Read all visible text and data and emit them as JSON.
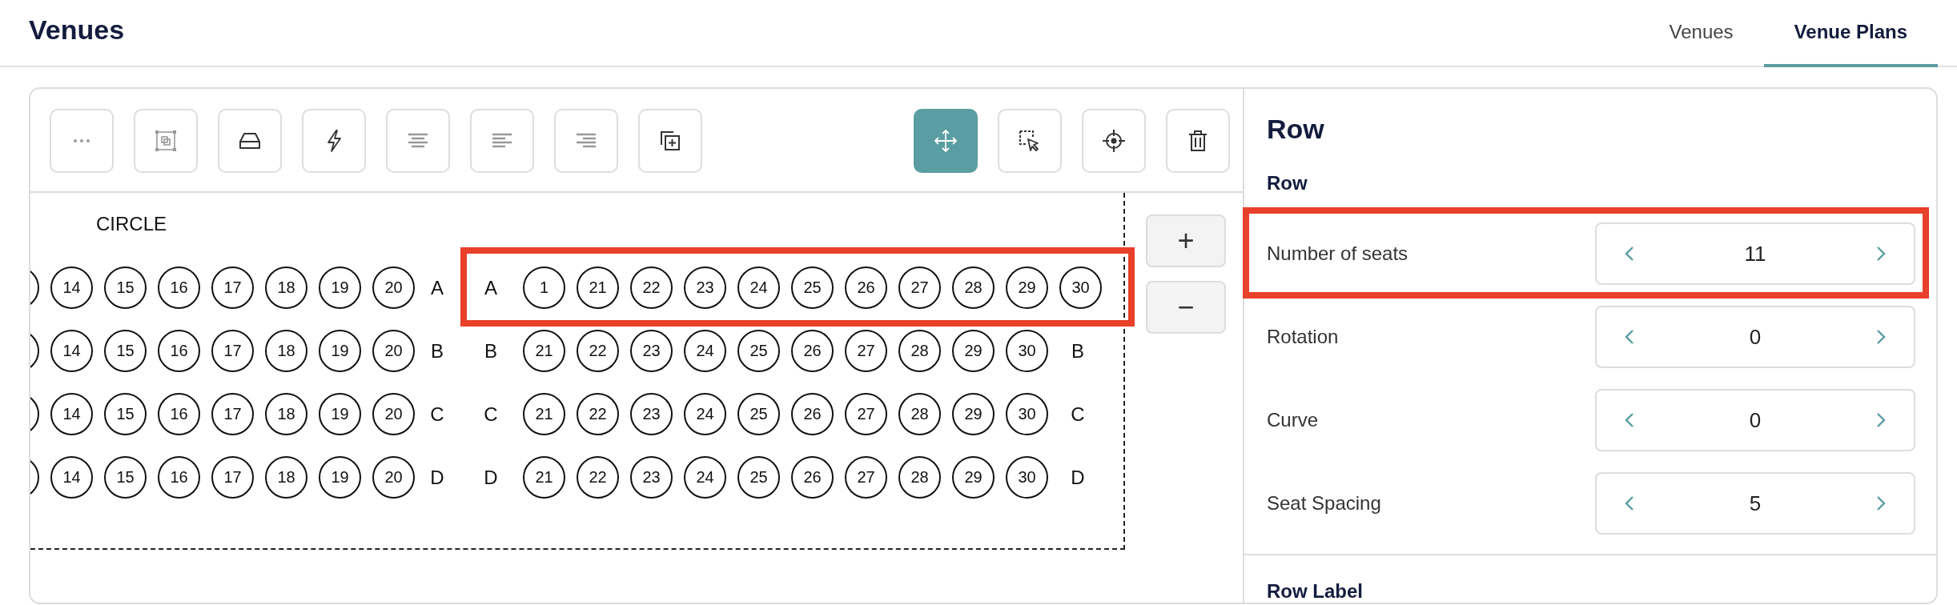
{
  "header": {
    "title": "Venues"
  },
  "tabs": [
    {
      "label": "Venues",
      "selected": false
    },
    {
      "label": "Venue Plans",
      "selected": true
    }
  ],
  "toolbar": {
    "left": [
      {
        "kind": "more",
        "selected": false
      },
      {
        "kind": "frame",
        "selected": false
      },
      {
        "kind": "tray",
        "selected": false
      },
      {
        "kind": "lightning",
        "selected": false
      },
      {
        "kind": "align-center",
        "selected": false
      },
      {
        "kind": "align-left",
        "selected": false
      },
      {
        "kind": "align-right",
        "selected": false
      },
      {
        "kind": "duplicate",
        "selected": false
      }
    ],
    "right": [
      {
        "kind": "move",
        "selected": true
      },
      {
        "kind": "select",
        "selected": false
      },
      {
        "kind": "target",
        "selected": false
      },
      {
        "kind": "delete",
        "selected": false
      }
    ]
  },
  "seat_map": {
    "section_label": "CIRCLE",
    "rows": [
      {
        "left_seats": [
          "14",
          "15",
          "16",
          "17",
          "18",
          "19",
          "20"
        ],
        "left_label": "A",
        "right_label": "A",
        "right_seats": [
          "1",
          "21",
          "22",
          "23",
          "24",
          "25",
          "26",
          "27",
          "28",
          "29",
          "30"
        ],
        "highlighted": true
      },
      {
        "left_seats": [
          "14",
          "15",
          "16",
          "17",
          "18",
          "19",
          "20"
        ],
        "left_label": "B",
        "right_label": "B",
        "right_seats": [
          "21",
          "22",
          "23",
          "24",
          "25",
          "26",
          "27",
          "28",
          "29",
          "30"
        ],
        "end_label": "B",
        "highlighted": false
      },
      {
        "left_seats": [
          "14",
          "15",
          "16",
          "17",
          "18",
          "19",
          "20"
        ],
        "left_label": "C",
        "right_label": "C",
        "right_seats": [
          "21",
          "22",
          "23",
          "24",
          "25",
          "26",
          "27",
          "28",
          "29",
          "30"
        ],
        "end_label": "C",
        "highlighted": false
      },
      {
        "left_seats": [
          "14",
          "15",
          "16",
          "17",
          "18",
          "19",
          "20"
        ],
        "left_label": "D",
        "right_label": "D",
        "right_seats": [
          "21",
          "22",
          "23",
          "24",
          "25",
          "26",
          "27",
          "28",
          "29",
          "30"
        ],
        "end_label": "D",
        "highlighted": false
      }
    ]
  },
  "zoom_controls": [
    "+",
    "−"
  ],
  "panel": {
    "title": "Row",
    "section": "Row",
    "fields": [
      {
        "label": "Number of seats",
        "value": "11",
        "highlighted": true
      },
      {
        "label": "Rotation",
        "value": "0",
        "highlighted": false
      },
      {
        "label": "Curve",
        "value": "0",
        "highlighted": false
      },
      {
        "label": "Seat Spacing",
        "value": "5",
        "highlighted": false
      }
    ],
    "next_section": "Row Label"
  }
}
